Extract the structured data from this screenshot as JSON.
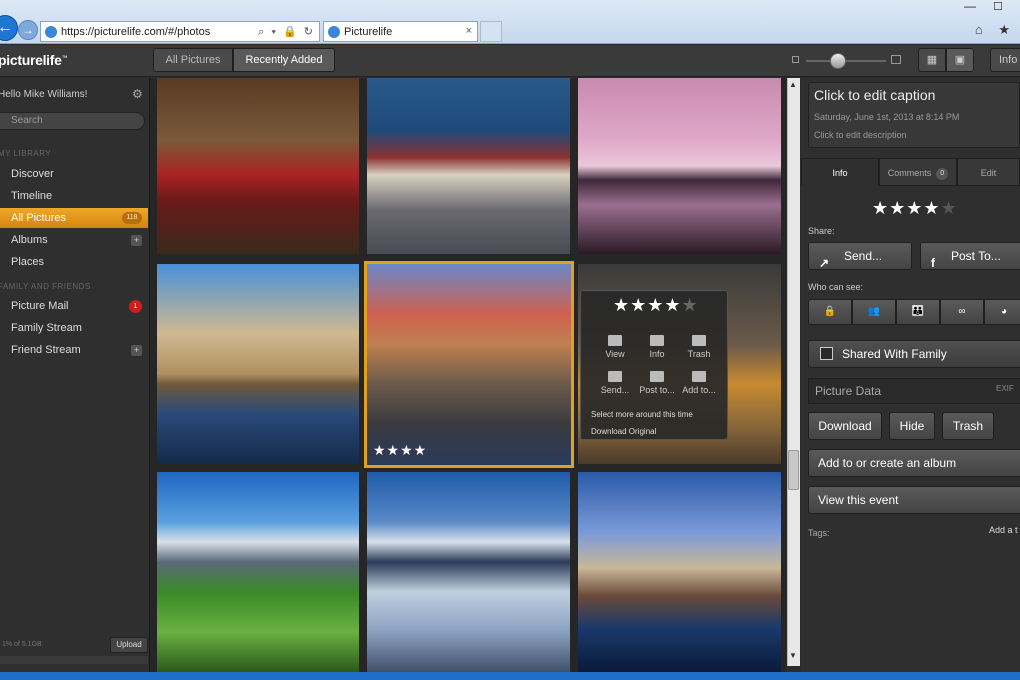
{
  "browser": {
    "url": "https://picturelife.com/#/photos",
    "tab_title": "Picturelife",
    "tab_close": "×",
    "addr_actions": "⌕ ▾ 🔒 ↻",
    "back": "←",
    "forward": "→",
    "minimize": "—",
    "maximize": "☐",
    "toolbar_icons": "⌂ ★"
  },
  "app": {
    "logo": "picturelife",
    "logo_tm": "™",
    "greeting": "Hello Mike Williams!",
    "search_placeholder": "Search",
    "segments": {
      "all": "All Pictures",
      "recent": "Recently Added"
    },
    "info_toggle": "Info",
    "view_grid_small": "▦",
    "view_grid_large": "▣"
  },
  "sidebar": {
    "section_library": "MY LIBRARY",
    "library_items": [
      {
        "label": "Discover"
      },
      {
        "label": "Timeline"
      },
      {
        "label": "All Pictures",
        "count": "118"
      },
      {
        "label": "Albums",
        "plus": "+"
      },
      {
        "label": "Places"
      }
    ],
    "section_family": "FAMILY AND FRIENDS",
    "family_items": [
      {
        "label": "Picture Mail",
        "badge": "1"
      },
      {
        "label": "Family Stream"
      },
      {
        "label": "Friend Stream",
        "plus": "+"
      }
    ],
    "storage": "1% of 5.1GB",
    "upload": "Upload",
    "gear": "⚙"
  },
  "grid": {
    "selected_stars": "★★★★"
  },
  "popup": {
    "stars_filled": "★★★★",
    "stars_empty": "★",
    "actions_row1": [
      "View",
      "Info",
      "Trash"
    ],
    "actions_row2": [
      "Send...",
      "Post to...",
      "Add to..."
    ],
    "select_more": "Select more around this time",
    "download_original": "Download Original"
  },
  "panel": {
    "caption": "Click to edit caption",
    "date": "Saturday, June 1st, 2013 at 8:14 PM",
    "description": "Click to edit description",
    "tabs": {
      "info": "Info",
      "comments": "Comments",
      "comments_count": "0",
      "edit": "Edit"
    },
    "stars_filled": "★★★★",
    "stars_empty": "★",
    "share_label": "Share:",
    "send": "Send...",
    "post_to": "Post To...",
    "send_icon": "↗",
    "post_icon": "f",
    "who_can_see": "Who can see:",
    "privacy_icons": [
      "🔒",
      "👥",
      "👪",
      "∞",
      "◕"
    ],
    "shared_with_family": "Shared With Family",
    "picture_data": "Picture Data",
    "exif": "EXIF",
    "download": "Download",
    "hide": "Hide",
    "trash": "Trash",
    "add_album": "Add to or create an album",
    "view_event": "View this event",
    "tags_label": "Tags:",
    "add_tag": "Add a t"
  },
  "scroll": {
    "up": "▲",
    "down": "▼"
  }
}
